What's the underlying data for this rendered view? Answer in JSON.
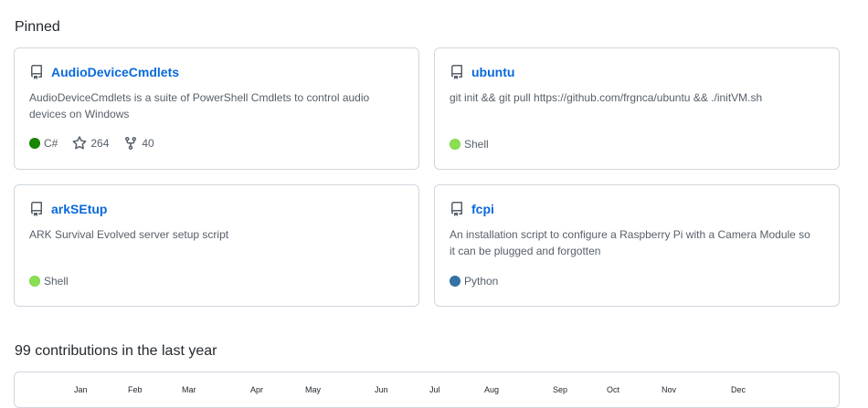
{
  "pinned": {
    "heading": "Pinned",
    "repos": [
      {
        "name": "AudioDeviceCmdlets",
        "description": "AudioDeviceCmdlets is a suite of PowerShell Cmdlets to control audio devices on Windows",
        "language": "C#",
        "language_color": "#178600",
        "stars": "264",
        "forks": "40"
      },
      {
        "name": "ubuntu",
        "description": "git init && git pull https://github.com/frgnca/ubuntu && ./initVM.sh",
        "language": "Shell",
        "language_color": "#89e051"
      },
      {
        "name": "arkSEtup",
        "description": "ARK Survival Evolved server setup script",
        "language": "Shell",
        "language_color": "#89e051"
      },
      {
        "name": "fcpi",
        "description": "An installation script to configure a Raspberry Pi with a Camera Module so it can be plugged and forgotten",
        "language": "Python",
        "language_color": "#3572A5"
      }
    ]
  },
  "contributions": {
    "heading": "99 contributions in the last year",
    "months": [
      "Jan",
      "Feb",
      "Mar",
      "Apr",
      "May",
      "Jun",
      "Jul",
      "Aug",
      "Sep",
      "Oct",
      "Nov",
      "Dec"
    ]
  },
  "icons": {
    "repo": "repo-icon",
    "star": "star-icon",
    "fork": "fork-icon"
  }
}
